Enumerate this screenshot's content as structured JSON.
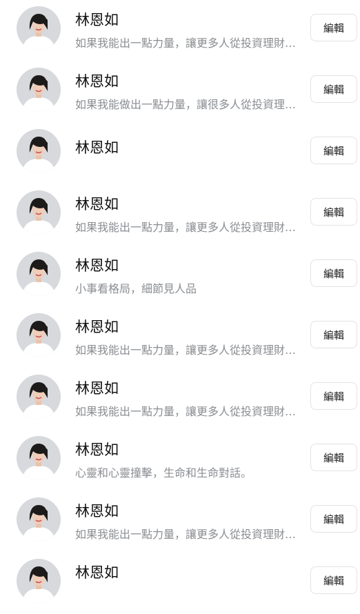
{
  "list": {
    "items": [
      {
        "name": "林恩如",
        "subtitle": "如果我能出一點力量，讓更多人從投資理財中獲益",
        "edit_label": "編輯"
      },
      {
        "name": "林恩如",
        "subtitle": "如果我能做出一點力量，讓很多人從投資理財中獲益",
        "edit_label": "編輯"
      },
      {
        "name": "林恩如",
        "subtitle": "",
        "edit_label": "編輯"
      },
      {
        "name": "林恩如",
        "subtitle": "如果我能出一點力量，讓更多人從投資理財中獲益",
        "edit_label": "編輯"
      },
      {
        "name": "林恩如",
        "subtitle": "小事看格局，細節見人品",
        "edit_label": "編輯"
      },
      {
        "name": "林恩如",
        "subtitle": "如果我能出一點力量，讓更多人從投資理財中獲益",
        "edit_label": "編輯"
      },
      {
        "name": "林恩如",
        "subtitle": "如果我能出一點力量，讓更多人從投資理財中獲益",
        "edit_label": "編輯"
      },
      {
        "name": "林恩如",
        "subtitle": "心靈和心靈撞擊，生命和生命對話。",
        "edit_label": "編輯"
      },
      {
        "name": "林恩如",
        "subtitle": "如果我能出一點力量，讓更多人從投資理財中獲益",
        "edit_label": "編輯"
      },
      {
        "name": "林恩如",
        "subtitle": "",
        "edit_label": "編輯"
      }
    ]
  }
}
